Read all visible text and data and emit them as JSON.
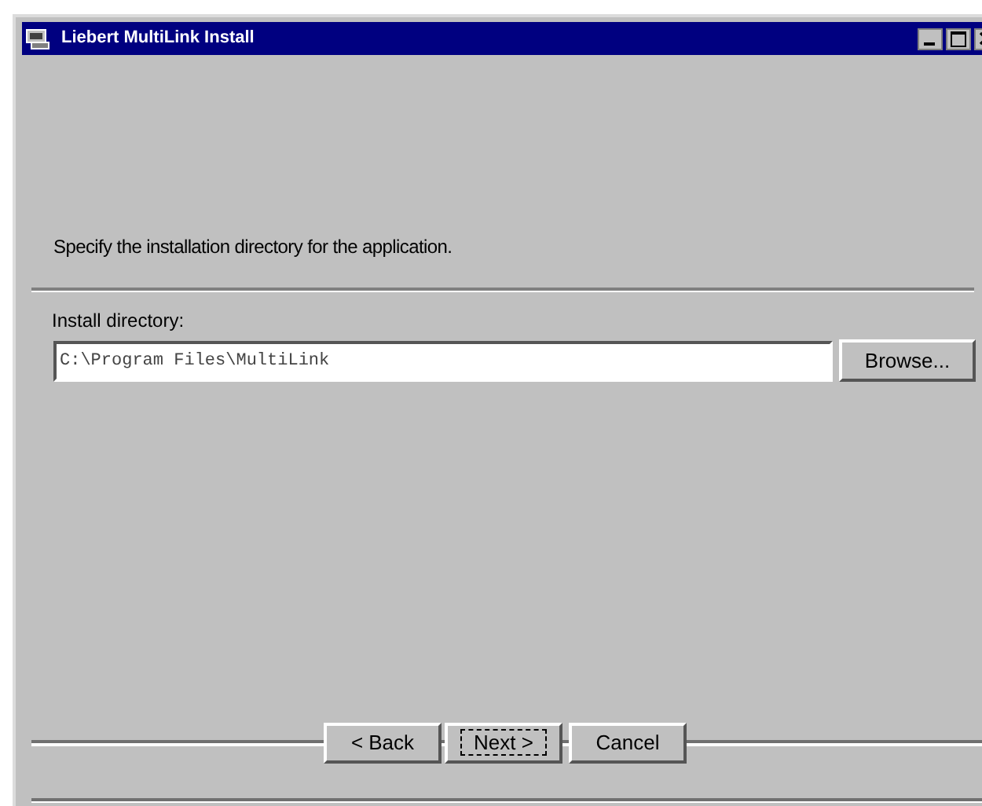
{
  "window": {
    "title": "Liebert MultiLink Install"
  },
  "instruction": "Specify the installation directory for the application.",
  "directory": {
    "label": "Install directory:",
    "value": "C:\\Program Files\\MultiLink",
    "button": "Browse..."
  },
  "buttons": [
    {
      "label": "< Back",
      "focused": false
    },
    {
      "label": "Next >",
      "focused": true
    },
    {
      "label": "Cancel",
      "focused": false
    }
  ]
}
